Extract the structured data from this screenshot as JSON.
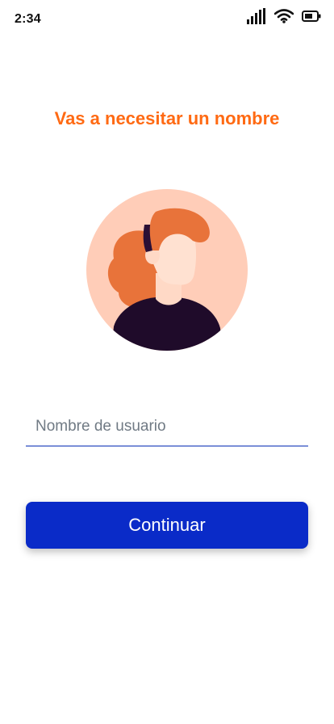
{
  "status_bar": {
    "time": "2:34",
    "icons": [
      "signal-icon",
      "wifi-icon",
      "battery-icon"
    ]
  },
  "screen": {
    "title": "Vas a necesitar un nombre",
    "avatar_icon": "avatar-illustration",
    "username_input": {
      "placeholder": "Nombre de usuario",
      "value": ""
    },
    "continue_label": "Continuar"
  },
  "colors": {
    "title": "#ff6a13",
    "button": "#0a2bc8",
    "input_underline": "#7b8fd8",
    "avatar_background": "#ffcdb8",
    "hair": "#e8733a"
  }
}
